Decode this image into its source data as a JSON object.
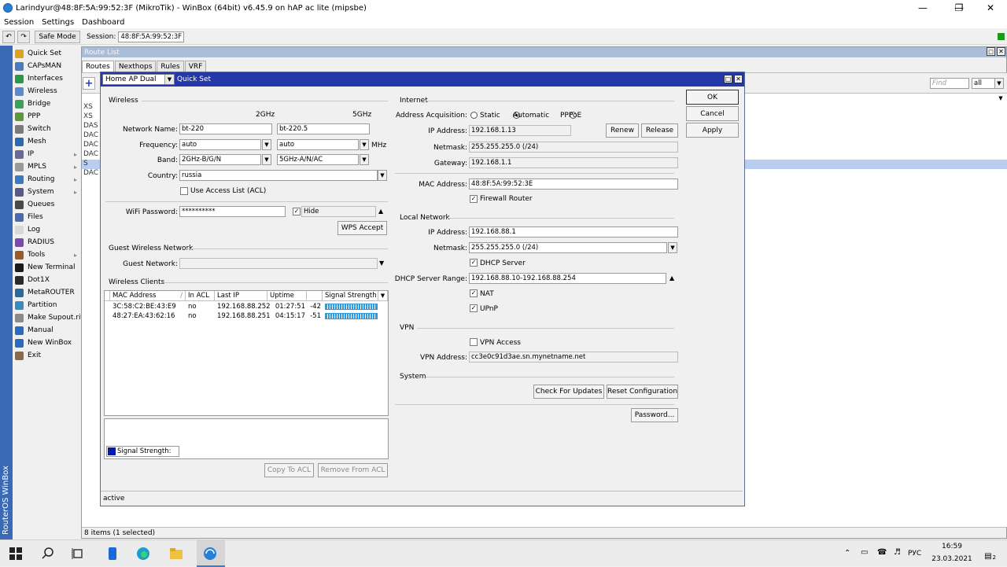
{
  "window": {
    "title": "Larindyur@48:8F:5A:99:52:3F (MikroTik) - WinBox (64bit) v6.45.9 on hAP ac lite (mipsbe)"
  },
  "menubar": [
    "Session",
    "Settings",
    "Dashboard"
  ],
  "toolbar": {
    "safe_mode": "Safe Mode",
    "session_label": "Session:",
    "session_value": "48:8F:5A:99:52:3F"
  },
  "sidebar": {
    "vertical_label": "RouterOS WinBox",
    "items": [
      {
        "label": "Quick Set",
        "icon": "quickset-icon",
        "color": "#e0a020",
        "arrow": false
      },
      {
        "label": "CAPsMAN",
        "icon": "capsman-icon",
        "color": "#4a7ac0",
        "arrow": false
      },
      {
        "label": "Interfaces",
        "icon": "interfaces-icon",
        "color": "#2a9a4a",
        "arrow": false
      },
      {
        "label": "Wireless",
        "icon": "wireless-icon",
        "color": "#5a8ad0",
        "arrow": false
      },
      {
        "label": "Bridge",
        "icon": "bridge-icon",
        "color": "#3aa05a",
        "arrow": false
      },
      {
        "label": "PPP",
        "icon": "ppp-icon",
        "color": "#5a9a3a",
        "arrow": false
      },
      {
        "label": "Switch",
        "icon": "switch-icon",
        "color": "#7a7a7a",
        "arrow": false
      },
      {
        "label": "Mesh",
        "icon": "mesh-icon",
        "color": "#2a6ab0",
        "arrow": false
      },
      {
        "label": "IP",
        "icon": "ip-icon",
        "color": "#6a6a9a",
        "arrow": true
      },
      {
        "label": "MPLS",
        "icon": "mpls-icon",
        "color": "#9a9a9a",
        "arrow": true
      },
      {
        "label": "Routing",
        "icon": "routing-icon",
        "color": "#3a7ac0",
        "arrow": true
      },
      {
        "label": "System",
        "icon": "system-icon",
        "color": "#5a5a8a",
        "arrow": true
      },
      {
        "label": "Queues",
        "icon": "queues-icon",
        "color": "#4a4a4a",
        "arrow": false
      },
      {
        "label": "Files",
        "icon": "files-icon",
        "color": "#4a6ab0",
        "arrow": false
      },
      {
        "label": "Log",
        "icon": "log-icon",
        "color": "#d8d8d8",
        "arrow": false
      },
      {
        "label": "RADIUS",
        "icon": "radius-icon",
        "color": "#7a4ab0",
        "arrow": false
      },
      {
        "label": "Tools",
        "icon": "tools-icon",
        "color": "#9a5a2a",
        "arrow": true
      },
      {
        "label": "New Terminal",
        "icon": "terminal-icon",
        "color": "#1a1a1a",
        "arrow": false
      },
      {
        "label": "Dot1X",
        "icon": "dot1x-icon",
        "color": "#2a2a2a",
        "arrow": false
      },
      {
        "label": "MetaROUTER",
        "icon": "metarouter-icon",
        "color": "#2a6a9a",
        "arrow": false
      },
      {
        "label": "Partition",
        "icon": "partition-icon",
        "color": "#3a8ac0",
        "arrow": false
      },
      {
        "label": "Make Supout.rif",
        "icon": "supout-icon",
        "color": "#8a8a8a",
        "arrow": false
      },
      {
        "label": "Manual",
        "icon": "manual-icon",
        "color": "#2a6ac0",
        "arrow": false
      },
      {
        "label": "New WinBox",
        "icon": "winbox-icon",
        "color": "#2a6ac0",
        "arrow": false
      },
      {
        "label": "Exit",
        "icon": "exit-icon",
        "color": "#8a6a4a",
        "arrow": false
      }
    ]
  },
  "route_list": {
    "title": "Route List",
    "tabs": [
      "Routes",
      "Nexthops",
      "Rules",
      "VRF"
    ],
    "find_placeholder": "Find",
    "filter_value": "all",
    "row_flags": [
      "XS",
      "XS",
      "DAS",
      "DAC",
      "DAC",
      "DAC",
      "S",
      "DAC"
    ],
    "status": "8 items (1 selected)"
  },
  "quickset": {
    "mode": "Home AP Dual",
    "title": "Quick Set",
    "wireless": {
      "section": "Wireless",
      "col_2ghz": "2GHz",
      "col_5ghz": "5GHz",
      "network_name_label": "Network Name:",
      "network_name_2": "bt-220",
      "network_name_5": "bt-220.5",
      "frequency_label": "Frequency:",
      "frequency_2": "auto",
      "frequency_5": "auto",
      "mhz": "MHz",
      "band_label": "Band:",
      "band_2": "2GHz-B/G/N",
      "band_5": "5GHz-A/N/AC",
      "country_label": "Country:",
      "country": "russia",
      "use_acl": "Use Access List (ACL)",
      "wifi_password_label": "WiFi Password:",
      "wifi_password": "**********",
      "hide": "Hide",
      "wps_accept": "WPS Accept"
    },
    "guest": {
      "section": "Guest Wireless Network",
      "guest_network_label": "Guest Network:"
    },
    "clients": {
      "section": "Wireless Clients",
      "columns": [
        "MAC Address",
        "In ACL",
        "Last IP",
        "Uptime",
        "Signal Strength"
      ],
      "rows": [
        {
          "mac": "3C:58:C2:BE:43:E9",
          "acl": "no",
          "ip": "192.168.88.252",
          "uptime": "01:27:51",
          "signal": "-42"
        },
        {
          "mac": "48:27:EA:43:62:16",
          "acl": "no",
          "ip": "192.168.88.251",
          "uptime": "04:15:17",
          "signal": "-51"
        }
      ],
      "legend": "Signal Strength:",
      "copy_to_acl": "Copy To ACL",
      "remove_from_acl": "Remove From ACL"
    },
    "internet": {
      "section": "Internet",
      "acq_label": "Address Acquisition:",
      "acq_static": "Static",
      "acq_automatic": "Automatic",
      "acq_pppoe": "PPPoE",
      "ip_label": "IP Address:",
      "ip": "192.168.1.13",
      "renew": "Renew",
      "release": "Release",
      "netmask_label": "Netmask:",
      "netmask": "255.255.255.0 (/24)",
      "gateway_label": "Gateway:",
      "gateway": "192.168.1.1",
      "mac_label": "MAC Address:",
      "mac": "48:8F:5A:99:52:3E",
      "firewall_router": "Firewall Router"
    },
    "local": {
      "section": "Local Network",
      "ip_label": "IP Address:",
      "ip": "192.168.88.1",
      "netmask_label": "Netmask:",
      "netmask": "255.255.255.0 (/24)",
      "dhcp_server": "DHCP Server",
      "range_label": "DHCP Server Range:",
      "range": "192.168.88.10-192.168.88.254",
      "nat": "NAT",
      "upnp": "UPnP"
    },
    "vpn": {
      "section": "VPN",
      "vpn_access": "VPN Access",
      "address_label": "VPN Address:",
      "address": "cc3e0c91d3ae.sn.mynetname.net"
    },
    "system": {
      "section": "System",
      "check_updates": "Check For Updates",
      "reset": "Reset Configuration",
      "password": "Password..."
    },
    "buttons": {
      "ok": "OK",
      "cancel": "Cancel",
      "apply": "Apply"
    },
    "status": "active"
  },
  "taskbar": {
    "lang": "РУС",
    "time": "16:59",
    "date": "23.03.2021",
    "notifications": "2"
  }
}
